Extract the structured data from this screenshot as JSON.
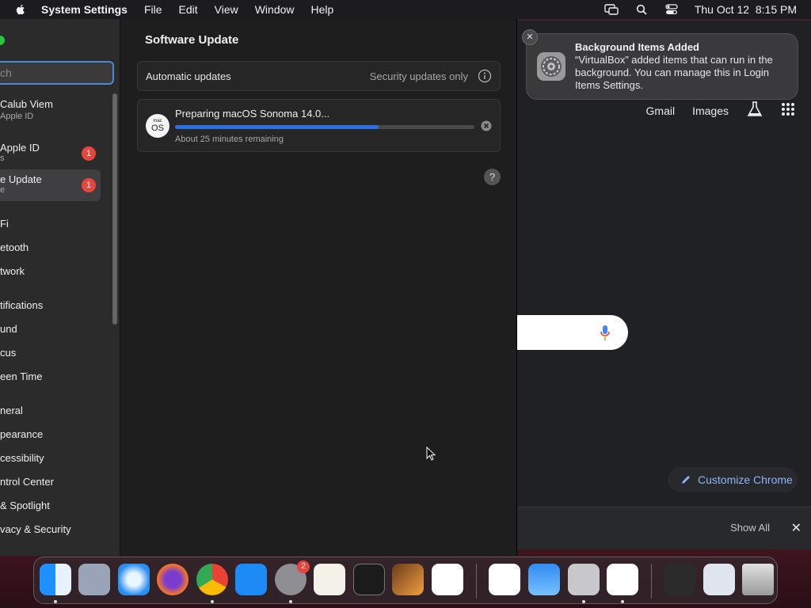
{
  "menubar": {
    "app_name": "System Settings",
    "menus": [
      "File",
      "Edit",
      "View",
      "Window",
      "Help"
    ],
    "clock": "Thu Oct 12  8:15 PM"
  },
  "sidebar": {
    "search_placeholder": "ch",
    "profile": {
      "name": "Calub Viem",
      "sub": "Apple ID"
    },
    "items": [
      {
        "label": "Apple ID",
        "sub": "s",
        "badge": "1"
      },
      {
        "label": "e Update",
        "sub": "e",
        "badge": "1",
        "selected": true
      },
      {
        "label": "Fi"
      },
      {
        "label": "etooth"
      },
      {
        "label": "twork"
      },
      {
        "label": "tifications"
      },
      {
        "label": "und"
      },
      {
        "label": "cus"
      },
      {
        "label": "een Time"
      },
      {
        "label": "neral"
      },
      {
        "label": "pearance"
      },
      {
        "label": "cessibility"
      },
      {
        "label": "ntrol Center"
      },
      {
        "label": "& Spotlight"
      },
      {
        "label": "vacy & Security"
      }
    ]
  },
  "content": {
    "title": "Software Update",
    "auto_updates": {
      "label": "Automatic updates",
      "value": "Security updates only"
    },
    "update": {
      "os_icon_small": "mac",
      "os_icon_big": "OS",
      "title": "Preparing macOS Sonoma 14.0...",
      "remaining": "About 25 minutes remaining",
      "progress": 0.68
    },
    "help": "?"
  },
  "notification": {
    "title": "Background Items Added",
    "body": "“VirtualBox” added items that can run in the background. You can manage this in Login Items Settings."
  },
  "chrome": {
    "gmail": "Gmail",
    "images": "Images",
    "customize": "Customize Chrome",
    "show_all": "Show All"
  },
  "dock": {
    "apps": [
      "Finder",
      "Launchpad",
      "Safari",
      "Firefox",
      "Chrome",
      "App Store",
      "System Settings",
      "TextEdit",
      "Terminal",
      "GarageBand",
      "VS Code",
      "Visual Studio",
      "Weather",
      "Disk Utility",
      "Freeform",
      "Downloads",
      "Documents",
      "Trash"
    ],
    "settings_badge": "2"
  },
  "colors": {
    "accent": "#2b6fe0",
    "badge": "#e8453c",
    "window_bg": "#1e1e1e",
    "sidebar_bg": "#2b2b2b"
  }
}
